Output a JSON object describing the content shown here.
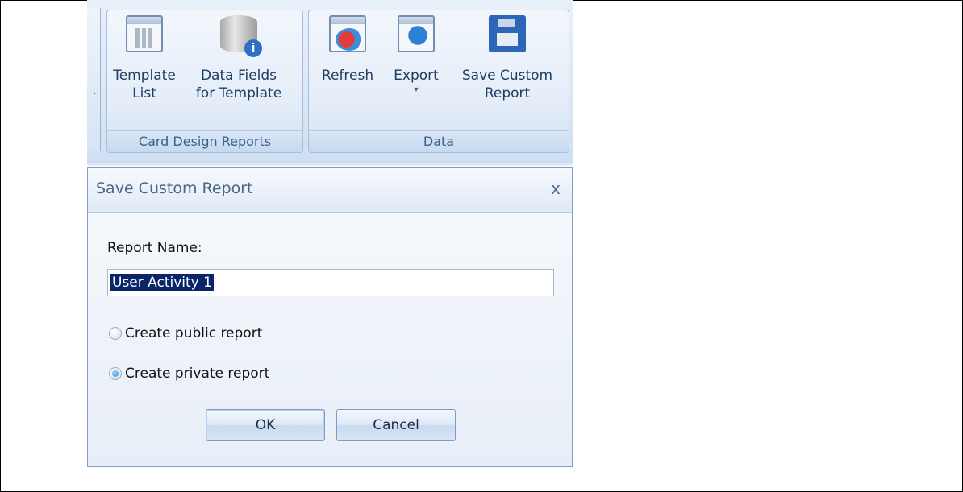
{
  "ribbon": {
    "groups": [
      {
        "label": "Card Design Reports",
        "buttons": [
          {
            "label": "Template\nList",
            "icon": "template-list-icon"
          },
          {
            "label": "Data Fields\nfor Template",
            "icon": "database-info-icon"
          }
        ]
      },
      {
        "label": "Data",
        "buttons": [
          {
            "label": "Refresh",
            "icon": "refresh-icon"
          },
          {
            "label": "Export",
            "icon": "export-icon",
            "dropdown": "▾"
          },
          {
            "label": "Save Custom\nReport",
            "icon": "save-floppy-icon"
          }
        ]
      }
    ]
  },
  "dialog": {
    "title": "Save Custom Report",
    "close_glyph": "x",
    "report_name_label": "Report Name:",
    "report_name_value": "User Activity 1",
    "radio_public_label": "Create public report",
    "radio_private_label": "Create private report",
    "selected_option": "private",
    "ok_label": "OK",
    "cancel_label": "Cancel"
  },
  "colors": {
    "ribbon_text": "#1e3d63",
    "group_label": "#3f5e85",
    "selection_bg": "#0a246a"
  }
}
